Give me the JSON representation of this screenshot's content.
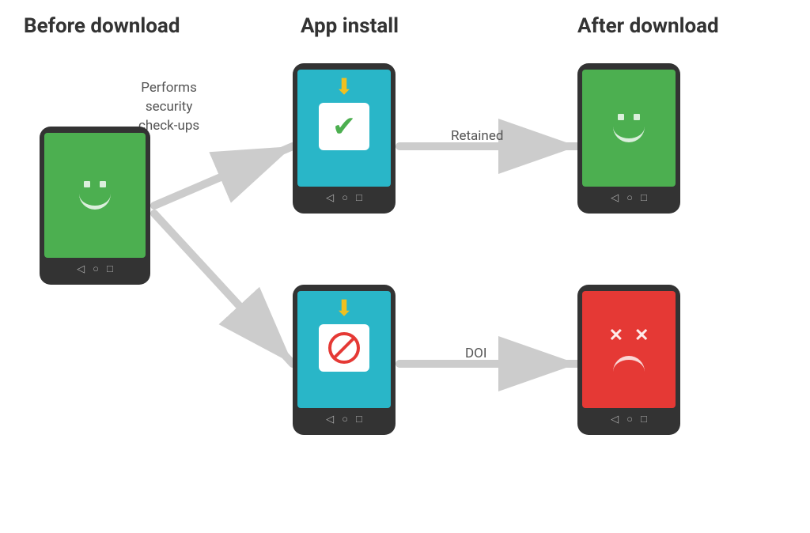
{
  "headers": {
    "before": "Before download",
    "install": "App install",
    "after": "After download"
  },
  "labels": {
    "security": "Performs\nsecurity\ncheck-ups",
    "retained": "Retained",
    "doi": "DOI"
  },
  "colors": {
    "green_screen": "#4caf50",
    "red_screen": "#e53935",
    "teal_screen": "#29b6c8",
    "phone_body": "#333333",
    "arrow_gray": "#cccccc",
    "checkmark_green": "#4caf50",
    "download_arrow_yellow": "#f0c020",
    "block_red": "#e53935"
  },
  "nav_icons": {
    "back": "◁",
    "home": "○",
    "recent": "□"
  }
}
